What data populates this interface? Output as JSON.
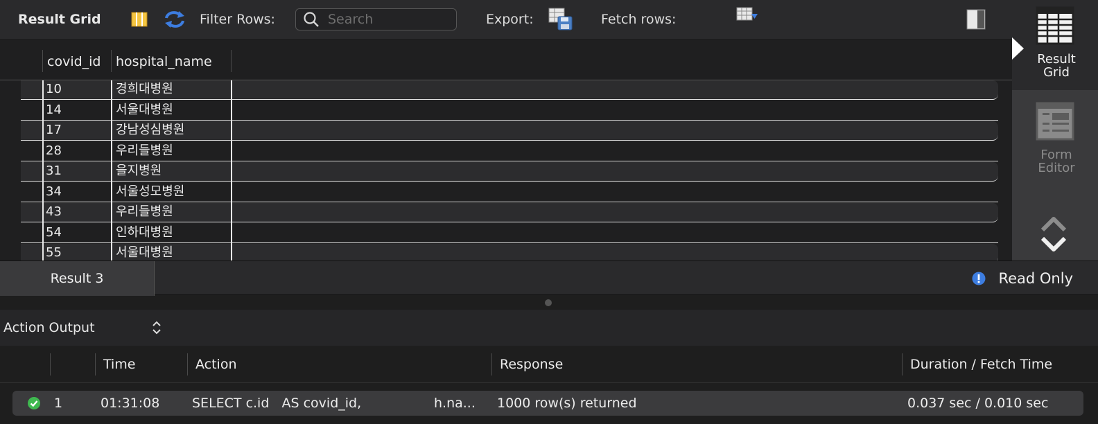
{
  "toolbar": {
    "title": "Result Grid",
    "filter_label": "Filter Rows:",
    "search_placeholder": "Search",
    "export_label": "Export:",
    "fetch_label": "Fetch rows:"
  },
  "grid": {
    "columns": [
      "covid_id",
      "hospital_name"
    ],
    "rows": [
      {
        "covid_id": "10",
        "hospital_name": "경희대병원"
      },
      {
        "covid_id": "14",
        "hospital_name": "서울대병원"
      },
      {
        "covid_id": "17",
        "hospital_name": "강남성심병원"
      },
      {
        "covid_id": "28",
        "hospital_name": "우리들병원"
      },
      {
        "covid_id": "31",
        "hospital_name": "을지병원"
      },
      {
        "covid_id": "34",
        "hospital_name": "서울성모병원"
      },
      {
        "covid_id": "43",
        "hospital_name": "우리들병원"
      },
      {
        "covid_id": "54",
        "hospital_name": "인하대병원"
      },
      {
        "covid_id": "55",
        "hospital_name": "서울대병원"
      }
    ]
  },
  "side_panel": {
    "result_grid_line1": "Result",
    "result_grid_line2": "Grid",
    "form_editor_line1": "Form",
    "form_editor_line2": "Editor"
  },
  "tabs": {
    "active_tab": "Result 3",
    "read_only": "Read Only"
  },
  "action_output": {
    "selector_label": "Action Output",
    "columns": {
      "time": "Time",
      "action": "Action",
      "response": "Response",
      "duration": "Duration / Fetch Time"
    },
    "rows": [
      {
        "index": "1",
        "time": "01:31:08",
        "action": "SELECT c.id   AS covid_id,",
        "action_tail": "h.na...",
        "response": "1000 row(s) returned",
        "duration": "0.037 sec / 0.010 sec",
        "status_icon": "check-circle-icon"
      }
    ]
  },
  "colors": {
    "accent_blue": "#3d7de0",
    "success_green": "#3fb950",
    "panel_bg": "#2a2a2c"
  }
}
